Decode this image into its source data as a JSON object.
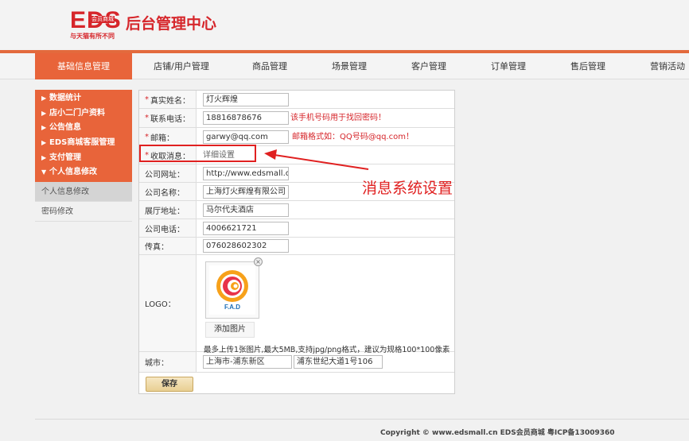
{
  "header": {
    "logo_text": "EDS",
    "logo_cn": "会员商城",
    "slogan": "与天猫有所不同",
    "title": "后台管理中心"
  },
  "nav": {
    "items": [
      {
        "label": "基础信息管理",
        "active": true
      },
      {
        "label": "店铺/用户管理"
      },
      {
        "label": "商品管理"
      },
      {
        "label": "场景管理"
      },
      {
        "label": "客户管理"
      },
      {
        "label": "订单管理"
      },
      {
        "label": "售后管理"
      },
      {
        "label": "营销活动"
      }
    ]
  },
  "sidebar": {
    "items": [
      {
        "label": "数据统计",
        "arrow": "▶"
      },
      {
        "label": "店小二门户资料",
        "arrow": "▶"
      },
      {
        "label": "公告信息",
        "arrow": "▶"
      },
      {
        "label": "EDS商城客服管理",
        "arrow": "▶"
      },
      {
        "label": "支付管理",
        "arrow": "▶"
      },
      {
        "label": "个人信息修改",
        "arrow": "▼"
      }
    ],
    "subitems": [
      {
        "label": "个人信息修改",
        "active": true
      },
      {
        "label": "密码修改"
      }
    ]
  },
  "form": {
    "real_name": {
      "label": "真实姓名：",
      "value": "灯火辉煌"
    },
    "phone": {
      "label": "联系电话：",
      "value": "18816878676",
      "hint": "该手机号码用于找回密码！"
    },
    "email": {
      "label": "邮箱：",
      "value": "garwy@qq.com",
      "hint": "邮箱格式如：QQ号码@qq.com！"
    },
    "receive_msg": {
      "label": "收取消息：",
      "value": "详细设置"
    },
    "website": {
      "label": "公司网址：",
      "value": "http://www.edsmall.cn"
    },
    "company_name": {
      "label": "公司名称：",
      "value": "上海灯火辉煌有限公司"
    },
    "address": {
      "label": "展厅地址：",
      "value": "马尔代夫酒店"
    },
    "company_phone": {
      "label": "公司电话：",
      "value": "4006621721"
    },
    "fax": {
      "label": "传真：",
      "value": "076028602302"
    },
    "logo": {
      "label": "LOGO：",
      "image_text": "F.A.D",
      "add_button": "添加图片",
      "tip": "最多上传1张图片,最大5MB,支持jpg/png格式，建议为规格100*100像素"
    },
    "city": {
      "label": "城市：",
      "district": "上海市-浦东新区",
      "street": "浦东世纪大道1号106"
    },
    "save_label": "保存"
  },
  "annotation": {
    "text": "消息系统设置",
    "color": "#e02020"
  },
  "footer": {
    "copyright": "Copyright © www.edsmall.cn EDS会员商城 粤ICP备13009360"
  },
  "colors": {
    "accent": "#e8643a",
    "brand_red": "#d6262b"
  }
}
